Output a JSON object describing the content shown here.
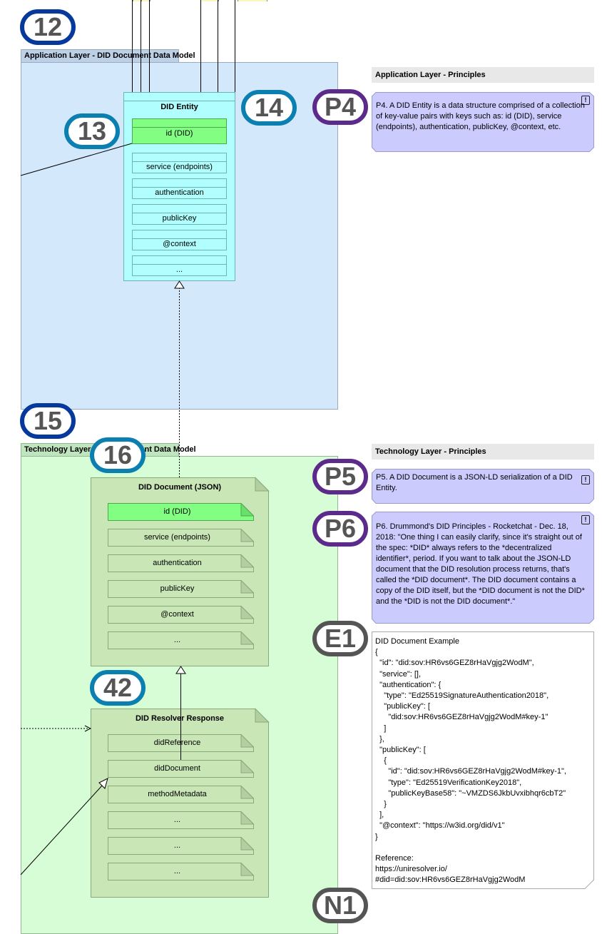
{
  "badges": {
    "b12": "12",
    "b13": "13",
    "b14": "14",
    "b15": "15",
    "b16": "16",
    "b42": "42",
    "p4": "P4",
    "p5": "P5",
    "p6": "P6",
    "e1": "E1",
    "n1": "N1"
  },
  "colors": {
    "app_layer_fill": "#d4e8fc",
    "tech_layer_fill": "#d6fdd6",
    "entity_fill": "#b0fefd",
    "highlight_field": "#82fe82",
    "artifact_fill": "#c9e6b6",
    "principle_fill": "#cccbfe",
    "navy_badge": "#06399b",
    "teal_badge": "#0a7fb0",
    "purple_badge": "#5b2a8a",
    "gray_badge": "#555555"
  },
  "application_layer": {
    "group_label": "Application Layer - DID Document Data Model",
    "entity": {
      "title": "DID Entity",
      "fields": [
        "id (DID)",
        "service (endpoints)",
        "authentication",
        "publicKey",
        "@context",
        "..."
      ]
    }
  },
  "technology_layer": {
    "group_label": "Technology Layer - DID Document Data Model",
    "did_document": {
      "title": "DID Document (JSON)",
      "fields": [
        "id (DID)",
        "service (endpoints)",
        "authentication",
        "publicKey",
        "@context",
        "..."
      ]
    },
    "resolver_response": {
      "title": "DID Resolver Response",
      "fields": [
        "didReference",
        "didDocument",
        "methodMetadata",
        "...",
        "...",
        "..."
      ]
    }
  },
  "principles": {
    "app_heading": "Application Layer - Principles",
    "tech_heading": "Technology Layer - Principles",
    "warn_glyph": "!",
    "p4": "P4. A DID Entity is a data structure comprised of a collection of key-value pairs with keys such as: id (DID), service (endpoints), authentication, publicKey, @context, etc.",
    "p5": "P5. A DID Document is a JSON-LD serialization of a DID Entity.",
    "p6": "P6. Drummond's DID Principles - Rocketchat - Dec. 18, 2018:   \"One thing I can easily clarify, since it's straight out of the spec: *DID* always refers to the *decentralized identifier*, period. If you want to talk about the JSON-LD document that the DID resolution process returns, that's called the *DID document*. The DID document contains a copy of the DID itself, but the *DID document is not the DID* and the *DID is not the DID document*.\""
  },
  "example": {
    "text": "DID Document Example\n{\n  \"id\": \"did:sov:HR6vs6GEZ8rHaVgjg2WodM\",\n  \"service\": [],\n  \"authentication\": {\n    \"type\": \"Ed25519SignatureAuthentication2018\",\n    \"publicKey\": [\n      \"did:sov:HR6vs6GEZ8rHaVgjg2WodM#key-1\"\n    ]\n  },\n  \"publicKey\": [\n    {\n      \"id\": \"did:sov:HR6vs6GEZ8rHaVgjg2WodM#key-1\",\n      \"type\": \"Ed25519VerificationKey2018\",\n      \"publicKeyBase58\": \"~VMZDS6JkbUvxibhqr6cbT2\"\n    }\n  ],\n  \"@context\": \"https://w3id.org/did/v1\"\n}\n\nReference:\nhttps://uniresolver.io/\n#did=did:sov:HR6vs6GEZ8rHaVgjg2WodM"
  }
}
